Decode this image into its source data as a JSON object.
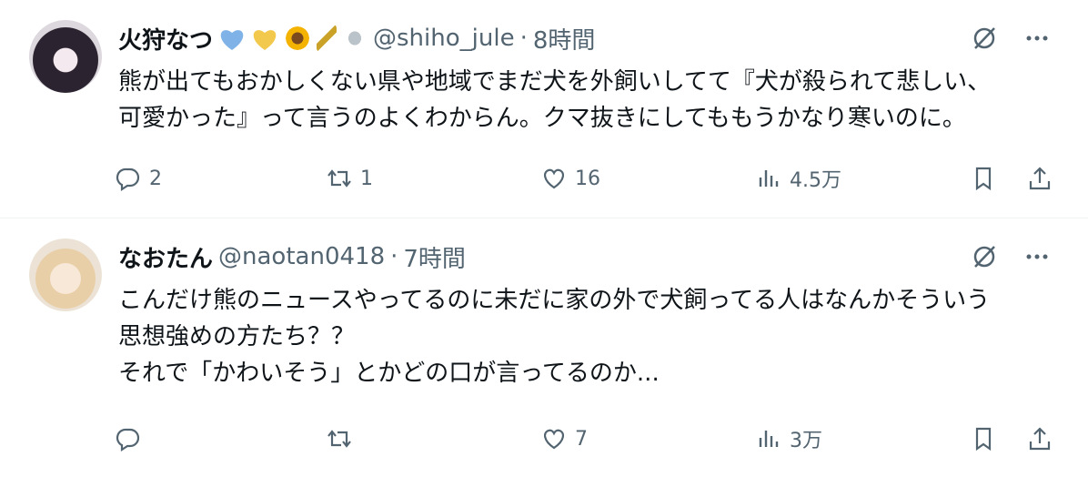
{
  "tweets": [
    {
      "display_name": "火狩なつ",
      "emojis": [
        "blue-heart-icon",
        "yellow-heart-icon",
        "sunflower-icon",
        "rice-icon",
        "dragonfly-icon"
      ],
      "handle": "@shiho_jule",
      "dot": "·",
      "time": "8時間",
      "lines": [
        "熊が出てもおかしくない県や地域でまだ犬を外飼いしてて『犬が殺られて悲しい、",
        "可愛かった』って言うのよくわからん。クマ抜きにしてももうかなり寒いのに。"
      ],
      "replies": "2",
      "retweets": "1",
      "likes": "16",
      "views": "4.5万"
    },
    {
      "display_name": "なおたん",
      "handle": "@naotan0418",
      "dot": "·",
      "time": "7時間",
      "lines": [
        "こんだけ熊のニュースやってるのに未だに家の外で犬飼ってる人はなんかそういう",
        "思想強めの方たち？？",
        "それで「かわいそう」とかどの口が言ってるのか..."
      ],
      "replies": "",
      "retweets": "",
      "likes": "7",
      "views": "3万"
    }
  ],
  "colors": {
    "text": "#0f1419",
    "secondary": "#536471",
    "divider": "#eff3f4"
  }
}
